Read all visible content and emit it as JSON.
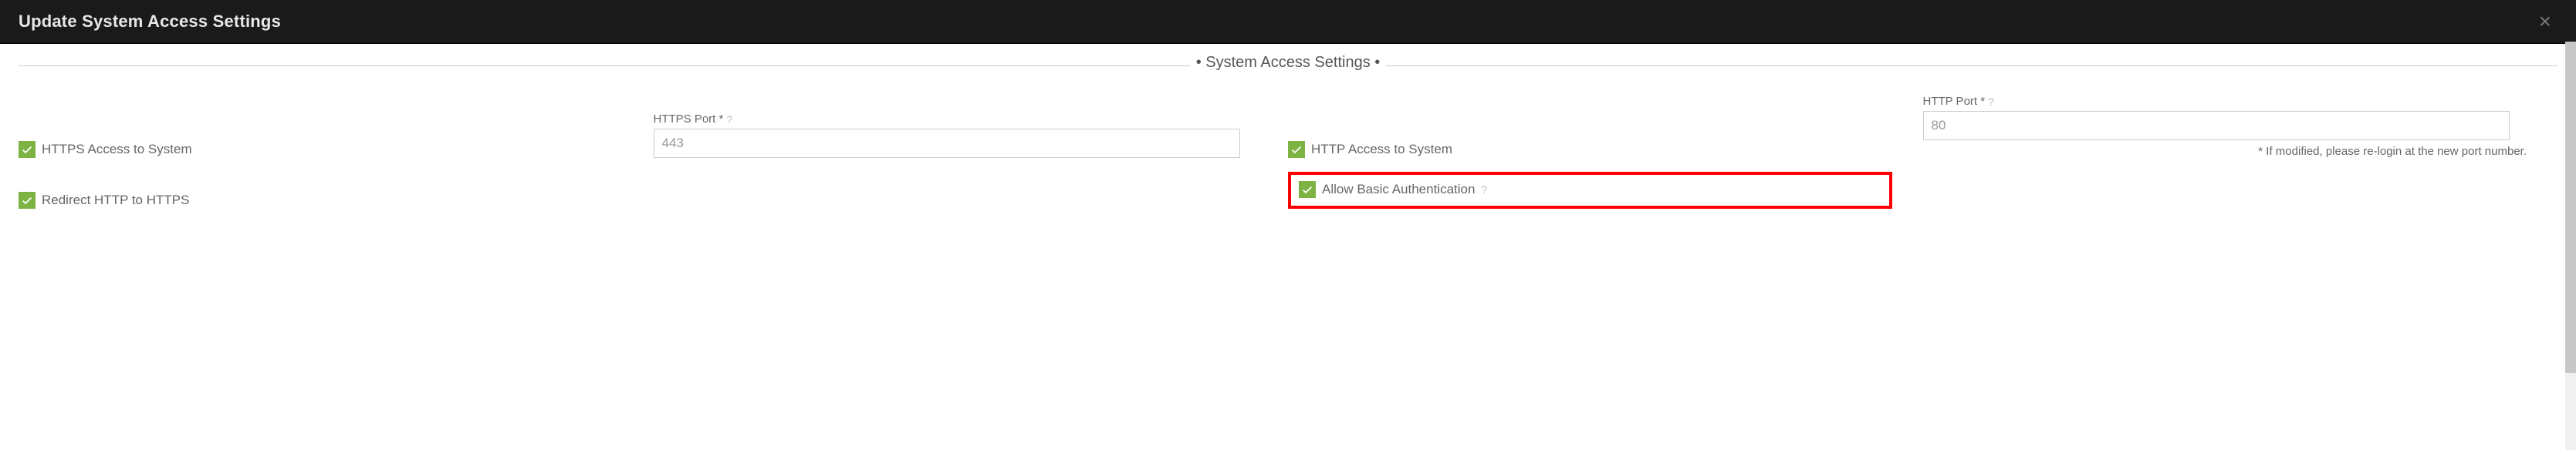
{
  "modal": {
    "title": "Update System Access Settings"
  },
  "section": {
    "title": "• System Access Settings •"
  },
  "fields": {
    "https_access": {
      "label": "HTTPS Access to System",
      "checked": true
    },
    "https_port": {
      "label": "HTTPS Port *",
      "value": "443"
    },
    "http_access": {
      "label": "HTTP Access to System",
      "checked": true
    },
    "http_port": {
      "label": "HTTP Port *",
      "value": "80"
    },
    "port_hint": "* If modified, please re-login at the new port number.",
    "redirect": {
      "label": "Redirect HTTP to HTTPS",
      "checked": true
    },
    "allow_basic": {
      "label": "Allow Basic Authentication",
      "checked": true
    }
  }
}
